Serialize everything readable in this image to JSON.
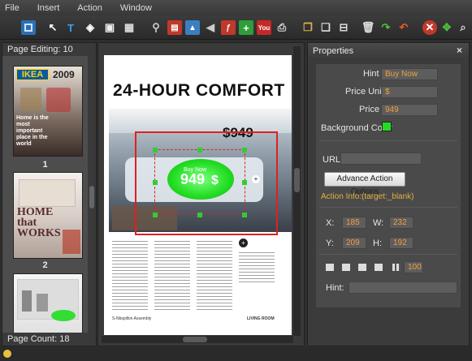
{
  "menu": [
    "File",
    "Insert",
    "Action",
    "Window"
  ],
  "toolbar_icons": [
    "save-icon",
    "select-arrow-icon",
    "text-icon",
    "tag-icon",
    "photo-icon",
    "table-icon",
    "link-icon",
    "film-icon",
    "image-icon",
    "audio-icon",
    "flash-icon",
    "add-icon",
    "youtube-icon",
    "print-icon",
    "copy-icon",
    "paste-icon",
    "align-icon",
    "trash-icon",
    "redo-icon",
    "undo-icon",
    "delete-icon",
    "network-icon",
    "zoom-icon"
  ],
  "left_panel": {
    "title": "Page Editing: 10",
    "footer": "Page Count: 18",
    "thumbs": [
      {
        "label": "1",
        "brand": "IKEA",
        "year": "2009",
        "text": "Home is the most important place in the world"
      },
      {
        "label": "2",
        "text": "HOME that WORKS"
      },
      {
        "label": "",
        "text": ""
      }
    ]
  },
  "page": {
    "title": "24-HOUR COMFORT",
    "price_tag": "$949",
    "button_price": "949",
    "button_currency": "$",
    "button_caption": "Buy Now",
    "footer_left": "S-Nbspillon Assembly",
    "footer_right": "LIVING ROOM"
  },
  "properties": {
    "title": "Properties",
    "hint_label": "Hint",
    "hint_value": "Buy Now",
    "price_unit_label": "Price Unit",
    "price_unit_value": "$",
    "price_label": "Price",
    "price_value": "949",
    "bg_color_label": "Background Color",
    "bg_color": "#22dd22",
    "url_label": "URL:",
    "url_value": "",
    "adv_button": "Advance Action Options",
    "action_info": "Action Info:(target:_blank)",
    "x_label": "X:",
    "x_value": "185",
    "w_label": "W:",
    "w_value": "232",
    "y_label": "Y:",
    "y_value": "209",
    "h_label": "H:",
    "h_value": "192",
    "opacity_value": "100",
    "hint2_label": "Hint:",
    "hint2_value": ""
  }
}
